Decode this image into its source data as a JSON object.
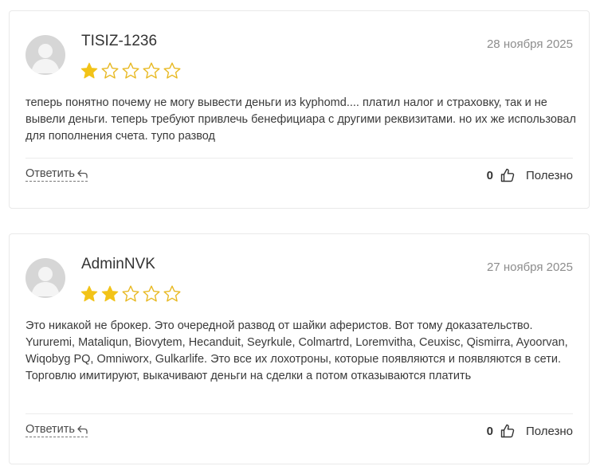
{
  "reviews": [
    {
      "author": "TISIZ-1236",
      "date": "28 ноября 2025",
      "rating": 1,
      "max_rating": 5,
      "text": "теперь понятно почему не могу вывести деньги из kyphomd.... платил налог и страховку, так и не вывели деньги. теперь требуют привлечь бенефициара с другими реквизитами. но их же использовал для пополнения счета. тупо развод",
      "reply_label": "Ответить",
      "helpful_count": "0",
      "helpful_label": "Полезно"
    },
    {
      "author": "AdminNVK",
      "date": "27 ноября 2025",
      "rating": 2,
      "max_rating": 5,
      "text": "Это никакой не брокер. Это очередной развод от шайки аферистов. Вот тому доказательство. Yururemi, Mataliqun, Biovytem, Hecanduit, Seyrkule, Colmartrd, Loremvitha, Ceuxisc, Qismirra, Ayoorvan, Wiqobyg PQ, Omniworx, Gulkarlife. Это все их лохотроны, которые появляются и появляются в сети. Торговлю имитируют, выкачивают деньги на сделки а потом отказываются платить",
      "reply_label": "Ответить",
      "helpful_count": "0",
      "helpful_label": "Полезно"
    }
  ],
  "colors": {
    "star_filled": "#f2c318",
    "star_outline": "#e8b923",
    "avatar_bg": "#d6d6d6",
    "avatar_fg": "#f4f4f4",
    "border": "#e9e9e9"
  },
  "icons": {
    "avatar": "user-silhouette-icon",
    "star": "star-icon",
    "reply": "reply-arrow-icon",
    "helpful": "thumbs-up-icon"
  }
}
